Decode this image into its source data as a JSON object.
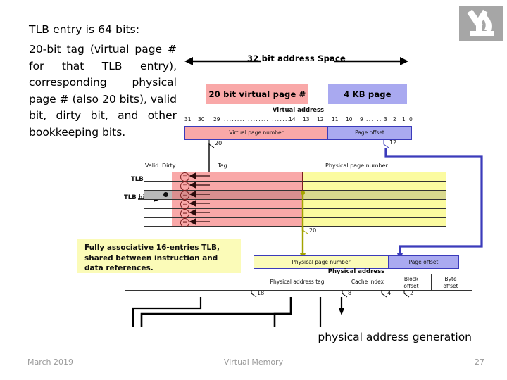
{
  "slide": {
    "lead_heading": "TLB entry is 64 bits:",
    "lead_body": "20-bit tag (virtual page # for that TLB entry), corresponding physical page # (also 20 bits), valid bit, dirty bit, and other bookkeeping bits.",
    "caption_physical": "physical address generation"
  },
  "logo": {
    "name": "microscope-logo",
    "color": "#a6a6a6"
  },
  "diagram": {
    "address_space_label": "32 bit address Space",
    "callouts": {
      "virtual_page": "20 bit virtual page #",
      "page_size": "4 KB page"
    },
    "virtual_address": {
      "title": "Virtual address",
      "bit_labels": [
        "31",
        "30",
        "29",
        "14",
        "13",
        "12",
        "11",
        "10",
        "9",
        "3",
        "2",
        "1",
        "0"
      ],
      "fields": [
        {
          "label": "Virtual page number",
          "color": "#f9a8a8",
          "width_bits": 20
        },
        {
          "label": "Page offset",
          "color": "#aaaaf0",
          "width_bits": 12
        }
      ],
      "tap_vpn": "20",
      "tap_offset": "12"
    },
    "tlb": {
      "name_label": "TLB",
      "hit_label": "TLB hit",
      "columns": [
        "Valid",
        "Dirty",
        "Tag",
        "Physical page number"
      ],
      "rows": 6,
      "hit_row_index": 3,
      "comparator_glyph": "=",
      "tag_color": "#f9a8a8",
      "ppn_color": "#fbfba0",
      "output_width": "20"
    },
    "note": "Fully associative 16-entries TLB, shared between instruction and data references.",
    "physical_address": {
      "title": "Physical address",
      "fields": [
        {
          "label": "Physical page number",
          "color": "#fbfbb8"
        },
        {
          "label": "Page offset",
          "color": "#aaaaf0"
        }
      ],
      "cache_fields": [
        {
          "label": "Physical address tag",
          "bits": "18"
        },
        {
          "label": "Cache index",
          "bits": "8"
        },
        {
          "label": "Block offset",
          "bits": "4"
        },
        {
          "label": "Byte offset",
          "bits": "2"
        }
      ]
    }
  },
  "footer": {
    "date": "March 2019",
    "title": "Virtual Memory",
    "page_number": "27"
  }
}
